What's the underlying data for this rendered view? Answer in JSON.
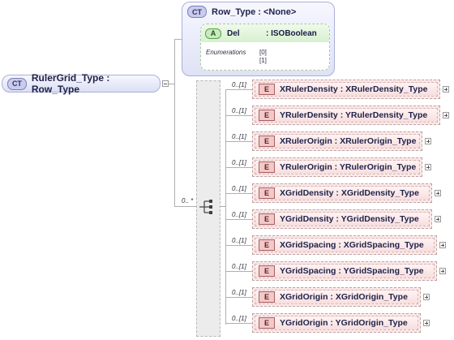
{
  "root": {
    "badge": "CT",
    "label": "RulerGrid_Type : Row_Type"
  },
  "base_type": {
    "badge": "CT",
    "title": "Row_Type : <None>",
    "attribute": {
      "badge": "A",
      "name": "Del",
      "type": ": ISOBoolean",
      "enumerations_label": "Enumerations",
      "enumerations": [
        "[0]",
        "[1]"
      ]
    }
  },
  "sequence": {
    "multiplicity": "0.. *"
  },
  "elements": [
    {
      "badge": "E",
      "label": "XRulerDensity : XRulerDensity_Type",
      "multiplicity": "0..[1]"
    },
    {
      "badge": "E",
      "label": "YRulerDensity : YRulerDensity_Type",
      "multiplicity": "0..[1]"
    },
    {
      "badge": "E",
      "label": "XRulerOrigin : XRulerOrigin_Type",
      "multiplicity": "0..[1]"
    },
    {
      "badge": "E",
      "label": "YRulerOrigin : YRulerOrigin_Type",
      "multiplicity": "0..[1]"
    },
    {
      "badge": "E",
      "label": "XGridDensity : XGridDensity_Type",
      "multiplicity": "0..[1]"
    },
    {
      "badge": "E",
      "label": "YGridDensity : YGridDensity_Type",
      "multiplicity": "0..[1]"
    },
    {
      "badge": "E",
      "label": "XGridSpacing : XGridSpacing_Type",
      "multiplicity": "0..[1]"
    },
    {
      "badge": "E",
      "label": "YGridSpacing : YGridSpacing_Type",
      "multiplicity": "0..[1]"
    },
    {
      "badge": "E",
      "label": "XGridOrigin : XGridOrigin_Type",
      "multiplicity": "0..[1]"
    },
    {
      "badge": "E",
      "label": "YGridOrigin : YGridOrigin_Type",
      "multiplicity": "0..[1]"
    }
  ]
}
